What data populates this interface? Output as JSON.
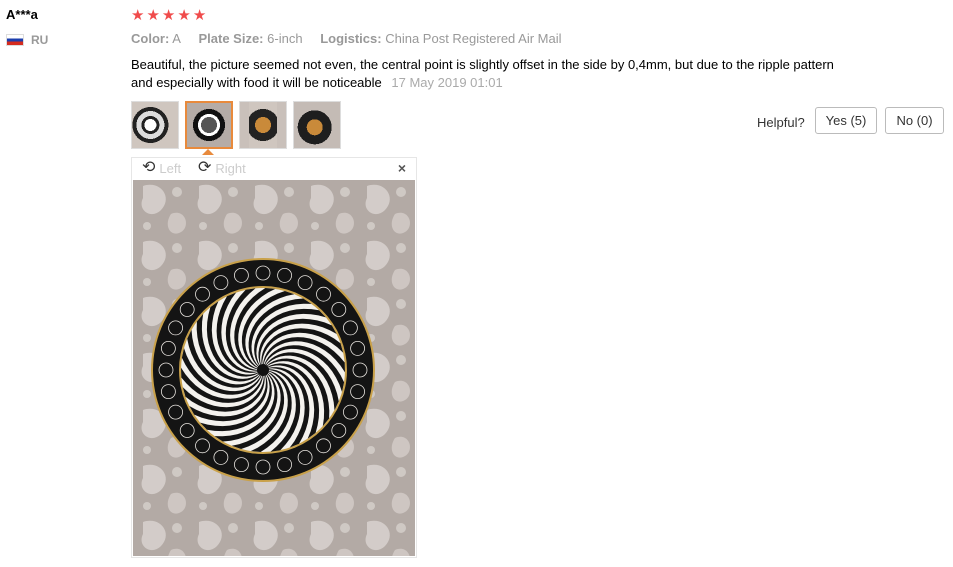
{
  "review": {
    "user": "A***a",
    "country": "RU",
    "rating": 5,
    "attributes": [
      {
        "key": "Color:",
        "value": "A"
      },
      {
        "key": "Plate Size:",
        "value": "6-inch"
      },
      {
        "key": "Logistics:",
        "value": "China Post Registered Air Mail"
      }
    ],
    "text": "Beautiful, the picture seemed not even, the central point is slightly offset in the side by 0,4mm, but due to the ripple pattern and especially with food it will be noticeable",
    "date": "17 May 2019 01:01"
  },
  "helpful": {
    "label": "Helpful?",
    "yes": "Yes (5)",
    "no": "No (0)"
  },
  "viewer": {
    "rotate_left": "Left",
    "rotate_right": "Right",
    "close": "×"
  },
  "colors": {
    "star": "#f04b4b",
    "thumb_active_border": "#e88a3c"
  }
}
